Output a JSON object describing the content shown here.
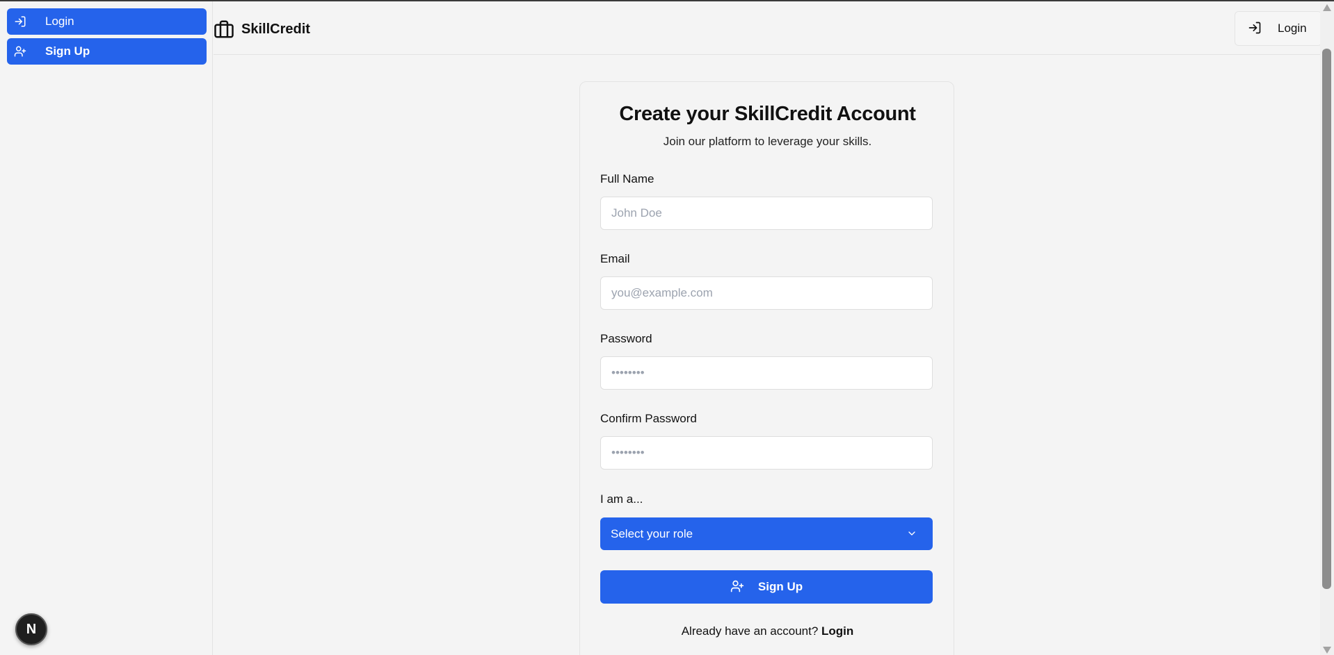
{
  "app": {
    "brand_name": "SkillCredit",
    "accent_color": "#2563eb",
    "brand_icon": "briefcase-icon"
  },
  "sidebar": {
    "items": [
      {
        "label": "Login",
        "icon": "log-in-icon"
      },
      {
        "label": "Sign Up",
        "icon": "user-plus-icon"
      }
    ],
    "dev_badge": "N"
  },
  "header": {
    "login_label": "Login",
    "login_icon": "log-in-icon"
  },
  "form": {
    "title": "Create your SkillCredit Account",
    "subtitle": "Join our platform to leverage your skills.",
    "full_name": {
      "label": "Full Name",
      "placeholder": "John Doe",
      "value": ""
    },
    "email": {
      "label": "Email",
      "placeholder": "you@example.com",
      "value": ""
    },
    "password": {
      "label": "Password",
      "placeholder": "••••••••",
      "value": ""
    },
    "confirm_password": {
      "label": "Confirm Password",
      "placeholder": "••••••••",
      "value": ""
    },
    "role": {
      "label": "I am a...",
      "selected": "Select your role"
    },
    "submit_label": "Sign Up",
    "footer_text": "Already have an account?",
    "footer_link": "Login"
  }
}
